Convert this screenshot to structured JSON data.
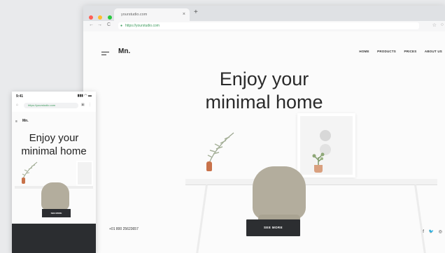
{
  "desktop": {
    "tab_title": "yourstudio.com",
    "tab_close": "×",
    "new_tab": "+",
    "url": "https://yourstudio.com",
    "nav_back": "←",
    "nav_forward": "→",
    "nav_reload": "C",
    "logo": "Mn.",
    "nav": [
      "HOME",
      "PRODUCTS",
      "PRICES",
      "ABOUT US"
    ],
    "hero_line1": "Enjoy your",
    "hero_line2": "minimal home",
    "cta": "SEE MORE",
    "phone": "+01 800 25623657",
    "social": [
      "f",
      "❦",
      "◎"
    ]
  },
  "mobile": {
    "time": "9:41",
    "signal": "▮▮▮ ◠ ▬",
    "url": "https://yourstudio.com",
    "logo": "Mn.",
    "hamb": "≡",
    "hero_line1": "Enjoy your",
    "hero_line2": "minimal home",
    "cta": "SEE MORE"
  },
  "colors": {
    "close": "#ff5f56",
    "minimize": "#ffbd2e",
    "zoom": "#27c93f",
    "button": "#2c2e31",
    "chair": "#b3ad9d",
    "secure": "#3a9a5b"
  }
}
